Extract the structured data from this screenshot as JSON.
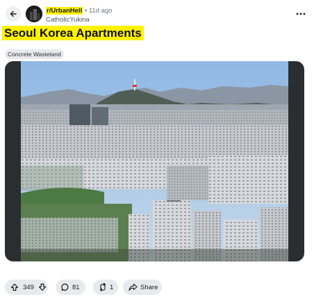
{
  "post": {
    "subreddit": "r/UrbanHell",
    "separator": "•",
    "age": "11d ago",
    "username": "CatholicYukina",
    "title": "Seoul Korea Apartments",
    "flair": "Concrete Wasteland"
  },
  "actions": {
    "score": "349",
    "comments": "81",
    "crossposts": "1",
    "share_label": "Share"
  },
  "icons": {
    "back": "arrow-left-icon",
    "more": "ellipsis-horizontal-icon",
    "upvote": "arrow-up-icon",
    "downvote": "arrow-down-icon",
    "comment": "speech-bubble-icon",
    "crosspost": "crosspost-icon",
    "share": "share-arrow-icon"
  },
  "colors": {
    "highlight": "#fff200",
    "pill_bg": "#e7e9ec",
    "media_frame": "#2a2e31"
  }
}
